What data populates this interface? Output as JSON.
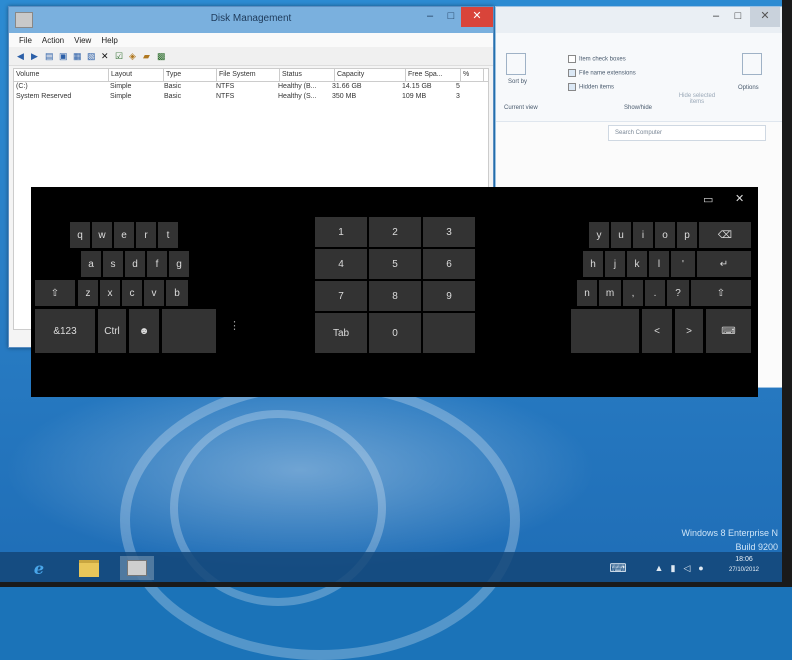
{
  "disk_window": {
    "title": "Disk Management",
    "controls": [
      "–",
      "□",
      "✕"
    ],
    "menu": [
      "File",
      "Action",
      "View",
      "Help"
    ],
    "toolbar_icons": [
      "back-icon",
      "forward-icon",
      "list-icon",
      "help-icon",
      "disk-icon",
      "settings-icon",
      "delete-icon",
      "check-icon",
      "search-icon",
      "folder-icon",
      "properties-icon"
    ],
    "columns": [
      "Volume",
      "Layout",
      "Type",
      "File System",
      "Status",
      "Capacity",
      "Free Spa...",
      "%"
    ],
    "rows": [
      [
        "(C:)",
        "Simple",
        "Basic",
        "NTFS",
        "Healthy (B...",
        "31.66 GB",
        "14.15 GB",
        "5"
      ],
      [
        "System Reserved",
        "Simple",
        "Basic",
        "NTFS",
        "Healthy (S...",
        "350 MB",
        "109 MB",
        "3"
      ]
    ]
  },
  "explorer_window": {
    "controls": [
      "–",
      "□",
      "✕"
    ],
    "ribbon": {
      "sort_by": "Sort by",
      "current_view": "Current view",
      "checkbox_item": "Item check boxes",
      "checkbox_ext": "File name extensions",
      "checkbox_hidden": "Hidden items",
      "hide_selected": "Hide selected items",
      "show_hide": "Show/hide",
      "options": "Options"
    },
    "search_placeholder": "Search Computer"
  },
  "keyboard": {
    "left": {
      "row1": [
        "q",
        "w",
        "e",
        "r",
        "t"
      ],
      "row2": [
        "a",
        "s",
        "d",
        "f",
        "g"
      ],
      "row3": [
        "⇧",
        "z",
        "x",
        "c",
        "v",
        "b"
      ],
      "row4": [
        "&123",
        "Ctrl",
        "☻",
        ""
      ],
      "more": "⋮"
    },
    "numpad": {
      "row1": [
        "1",
        "2",
        "3"
      ],
      "row2": [
        "4",
        "5",
        "6"
      ],
      "row3": [
        "7",
        "8",
        "9"
      ],
      "row4": [
        "Tab",
        "0",
        ""
      ]
    },
    "right": {
      "row1": [
        "y",
        "u",
        "i",
        "o",
        "p",
        "⌫"
      ],
      "row2": [
        "h",
        "j",
        "k",
        "l",
        "'",
        "↵"
      ],
      "row3": [
        "n",
        "m",
        ",",
        ".",
        "?",
        "⇧"
      ],
      "row4": [
        "",
        "<",
        ">",
        "⌨"
      ]
    },
    "top_controls": [
      "▭",
      "✕"
    ]
  },
  "watermark": {
    "line1": "Windows 8 Enterprise N",
    "line2": "Build 9200"
  },
  "taskbar": {
    "clock_time": "18:06",
    "clock_date": "27/10/2012"
  },
  "colors": {
    "accent": "#1f6db6",
    "keyboard_bg": "#000000",
    "key_bg": "#333333",
    "close_red": "#d9443a"
  }
}
